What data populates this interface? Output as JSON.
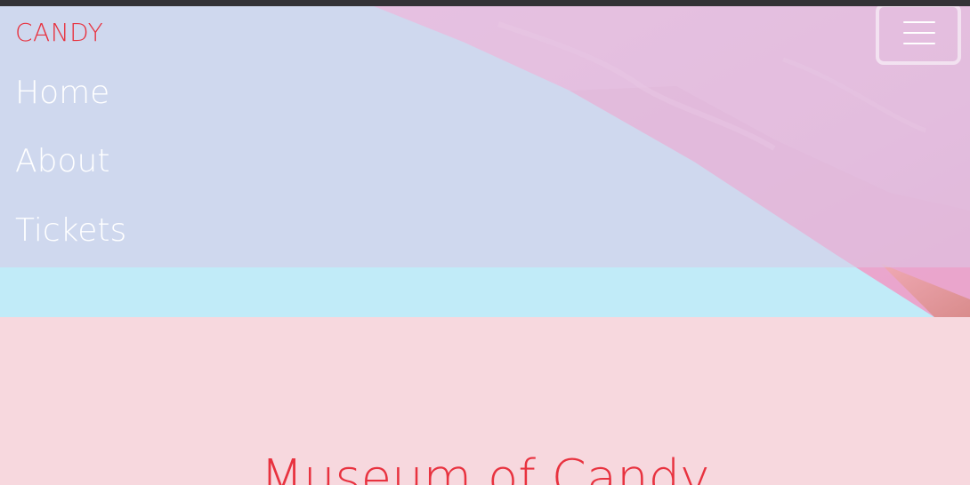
{
  "brand": {
    "name": "CANDY"
  },
  "nav": {
    "items": [
      {
        "label": "Home"
      },
      {
        "label": "About"
      },
      {
        "label": "Tickets"
      }
    ],
    "toggle_icon": "hamburger-menu-icon"
  },
  "hero": {
    "image": "cotton-candy-photo"
  },
  "main": {
    "title": "Museum of Candy"
  },
  "colors": {
    "accent": "#e8323f",
    "nav_overlay": "#dbc8e6",
    "hero_sky": "#c1ebf8",
    "page_background": "#f7d8de",
    "top_bar": "#333236"
  }
}
